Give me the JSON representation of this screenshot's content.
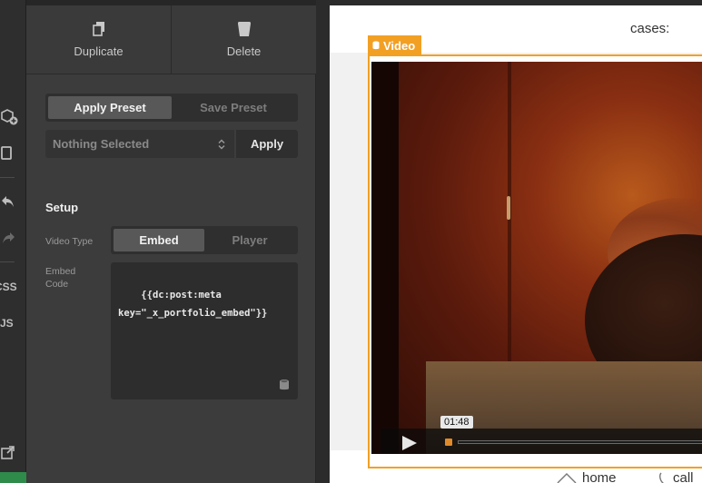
{
  "actions": {
    "duplicate": "Duplicate",
    "delete": "Delete"
  },
  "presets": {
    "apply_label": "Apply Preset",
    "save_label": "Save Preset",
    "select_value": "Nothing Selected",
    "apply_button": "Apply"
  },
  "setup": {
    "title": "Setup",
    "video_type_label": "Video Type",
    "video_type_options": [
      "Embed",
      "Player"
    ],
    "video_type_selected": "Embed",
    "embed_code_label": "Embed Code",
    "embed_code_value": "{{dc:post:meta\nkey=\"_x_portfolio_embed\"}}"
  },
  "rail": {
    "css_label": "CSS",
    "js_label": "JS"
  },
  "preview": {
    "cases_label": "cases:",
    "element_tag": "Video",
    "video_time": "01:48",
    "nav_home": "home",
    "nav_call": "call"
  },
  "colors": {
    "accent": "#f2a024",
    "panel_bg": "#3c3c3c",
    "rail_bg": "#2e2e2e"
  }
}
